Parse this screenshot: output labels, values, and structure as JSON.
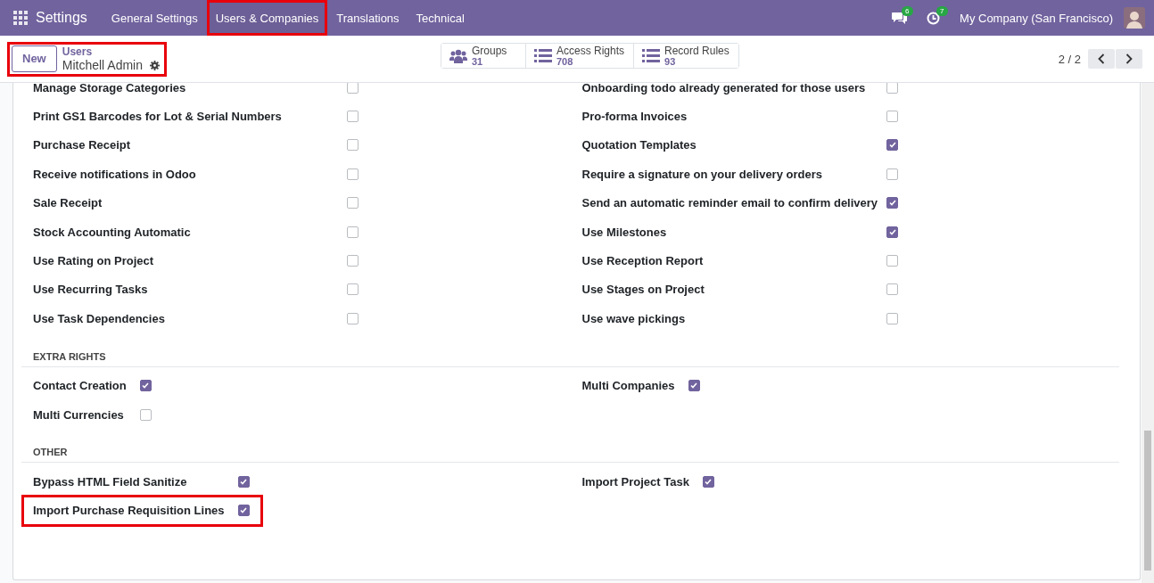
{
  "topbar": {
    "app": "Settings",
    "menu": [
      {
        "label": "General Settings",
        "highlighted": false
      },
      {
        "label": "Users & Companies",
        "highlighted": true
      },
      {
        "label": "Translations",
        "highlighted": false
      },
      {
        "label": "Technical",
        "highlighted": false
      }
    ],
    "messages_badge": "6",
    "activities_badge": "7",
    "company": "My Company (San Francisco)"
  },
  "control_panel": {
    "new_button": "New",
    "breadcrumb": {
      "parent": "Users",
      "current": "Mitchell Admin",
      "highlighted": true
    },
    "stat_buttons": [
      {
        "kind": "groups",
        "label": "Groups",
        "value": "31"
      },
      {
        "kind": "list",
        "label": "Access Rights",
        "value": "708"
      },
      {
        "kind": "list",
        "label": "Record Rules",
        "value": "93"
      }
    ],
    "pager": "2 / 2"
  },
  "sections": [
    {
      "kind": "wide",
      "left": [
        {
          "label": "Manage Storage Categories",
          "checked": false,
          "highlighted": false
        },
        {
          "label": "Print GS1 Barcodes for Lot & Serial Numbers",
          "checked": false,
          "highlighted": false
        },
        {
          "label": "Purchase Receipt",
          "checked": false,
          "highlighted": false
        },
        {
          "label": "Receive notifications in Odoo",
          "checked": false,
          "highlighted": false
        },
        {
          "label": "Sale Receipt",
          "checked": false,
          "highlighted": false
        },
        {
          "label": "Stock Accounting Automatic",
          "checked": false,
          "highlighted": false
        },
        {
          "label": "Use Rating on Project",
          "checked": false,
          "highlighted": false
        },
        {
          "label": "Use Recurring Tasks",
          "checked": false,
          "highlighted": false
        },
        {
          "label": "Use Task Dependencies",
          "checked": false,
          "highlighted": false
        }
      ],
      "right": [
        {
          "label": "Onboarding todo already generated for those users",
          "checked": false,
          "highlighted": false
        },
        {
          "label": "Pro-forma Invoices",
          "checked": false,
          "highlighted": false
        },
        {
          "label": "Quotation Templates",
          "checked": true,
          "highlighted": false
        },
        {
          "label": "Require a signature on your delivery orders",
          "checked": false,
          "highlighted": false
        },
        {
          "label": "Send an automatic reminder email to confirm delivery",
          "checked": true,
          "highlighted": false
        },
        {
          "label": "Use Milestones",
          "checked": true,
          "highlighted": false
        },
        {
          "label": "Use Reception Report",
          "checked": false,
          "highlighted": false
        },
        {
          "label": "Use Stages on Project",
          "checked": false,
          "highlighted": false
        },
        {
          "label": "Use wave pickings",
          "checked": false,
          "highlighted": false
        }
      ]
    },
    {
      "kind": "compact",
      "title": "EXTRA RIGHTS",
      "left": [
        {
          "label": "Contact Creation",
          "checked": true,
          "highlighted": false
        },
        {
          "label": "Multi Currencies",
          "checked": false,
          "highlighted": false
        }
      ],
      "right": [
        {
          "label": "Multi Companies",
          "checked": true,
          "highlighted": false
        }
      ]
    },
    {
      "kind": "compact",
      "title": "OTHER",
      "left": [
        {
          "label": "Bypass HTML Field Sanitize",
          "checked": true,
          "highlighted": false
        },
        {
          "label": "Import Purchase Requisition Lines",
          "checked": true,
          "highlighted": true
        }
      ],
      "right": [
        {
          "label": "Import Project Task",
          "checked": true,
          "highlighted": false
        }
      ]
    }
  ]
}
